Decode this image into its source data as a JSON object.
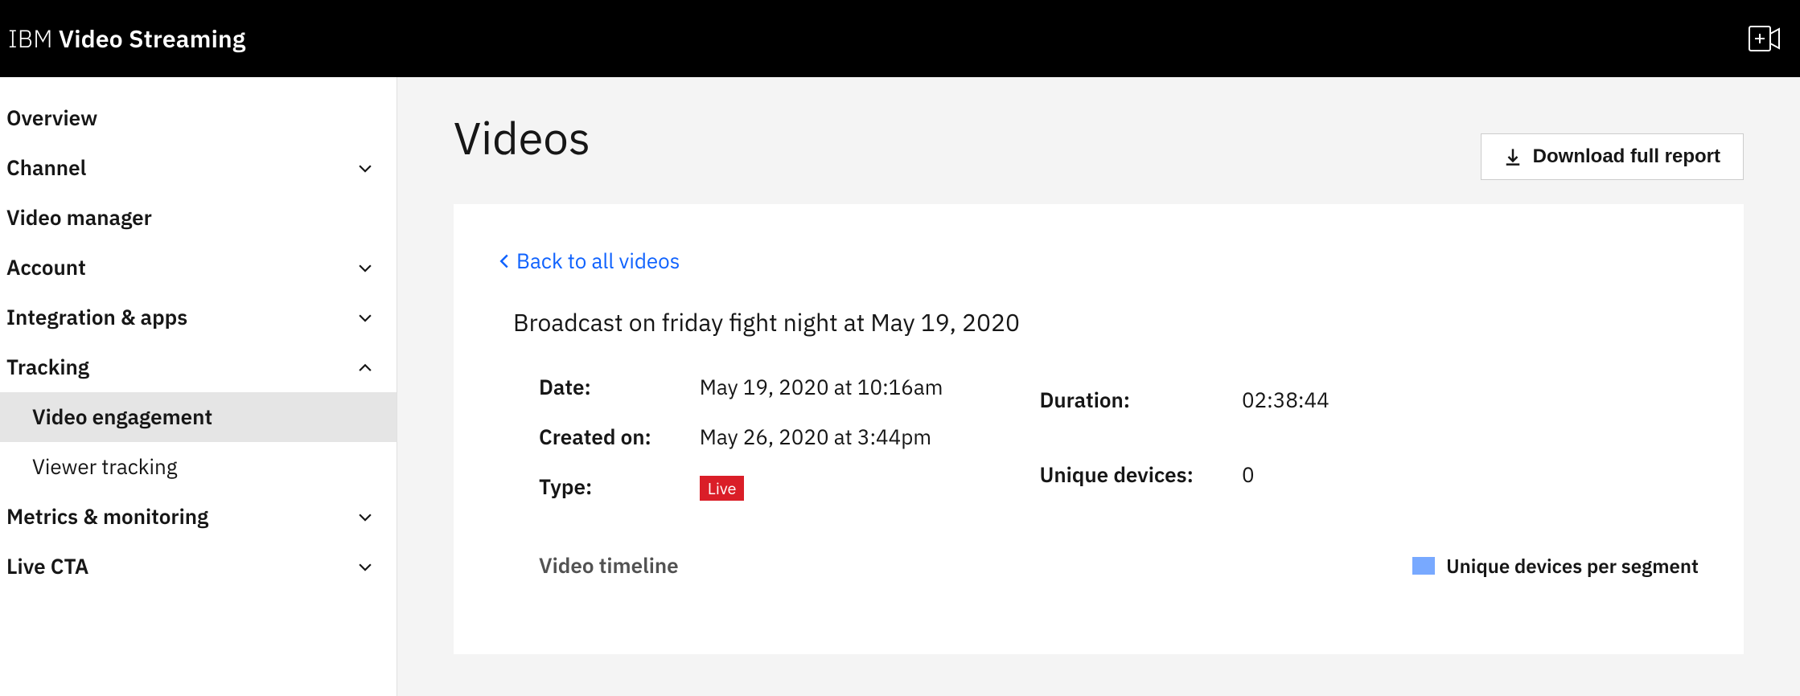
{
  "header": {
    "brand_prefix": "IBM",
    "brand_main": "Video Streaming"
  },
  "sidebar": {
    "items": [
      {
        "label": "Overview",
        "expandable": false
      },
      {
        "label": "Channel",
        "expandable": true,
        "expanded": false
      },
      {
        "label": "Video manager",
        "expandable": false
      },
      {
        "label": "Account",
        "expandable": true,
        "expanded": false
      },
      {
        "label": "Integration & apps",
        "expandable": true,
        "expanded": false
      },
      {
        "label": "Tracking",
        "expandable": true,
        "expanded": true,
        "children": [
          {
            "label": "Video engagement",
            "active": true
          },
          {
            "label": "Viewer tracking",
            "active": false
          }
        ]
      },
      {
        "label": "Metrics & monitoring",
        "expandable": true,
        "expanded": false
      },
      {
        "label": "Live CTA",
        "expandable": true,
        "expanded": false
      }
    ]
  },
  "main": {
    "page_title": "Videos",
    "download_button": "Download full report",
    "back_link": "Back to all videos",
    "video_title": "Broadcast on friday fight night at May 19, 2020",
    "meta": {
      "date_label": "Date:",
      "date_value": "May 19, 2020 at 10:16am",
      "created_label": "Created on:",
      "created_value": "May 26, 2020 at 3:44pm",
      "type_label": "Type:",
      "type_badge": "Live",
      "duration_label": "Duration:",
      "duration_value": "02:38:44",
      "unique_label": "Unique devices:",
      "unique_value": "0"
    },
    "timeline_heading": "Video timeline",
    "legend_label": "Unique devices per segment"
  },
  "colors": {
    "legend_swatch": "#78a9ff",
    "live_badge": "#da1e28",
    "link": "#0f62fe"
  }
}
